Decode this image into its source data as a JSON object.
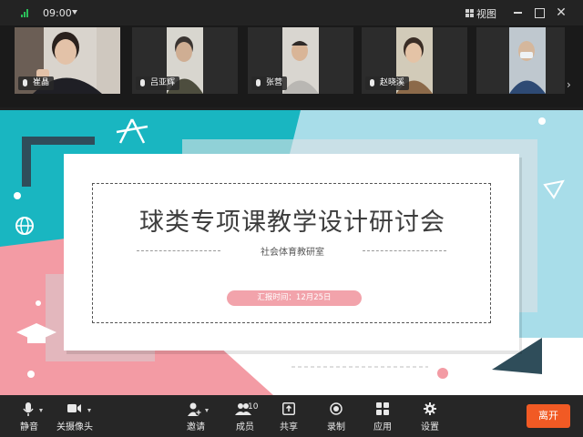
{
  "status_bar": {
    "time": "09:00",
    "view_label": "视图"
  },
  "participants": [
    {
      "name": "崔晶"
    },
    {
      "name": "吕亚辉"
    },
    {
      "name": "张营"
    },
    {
      "name": "赵晓溪"
    },
    {
      "name": ""
    }
  ],
  "slide": {
    "title": "球类专项课教学设计研讨会",
    "subtitle": "社会体育教研室",
    "date_text": "汇报时间：12月25日"
  },
  "toolbar": {
    "mute_label": "静音",
    "camera_label": "关摄像头",
    "invite_label": "邀请",
    "members_label": "成员",
    "members_count": "10",
    "share_label": "共享",
    "record_label": "录制",
    "apps_label": "应用",
    "settings_label": "设置",
    "leave_label": "离开"
  },
  "colors": {
    "accent_leave": "#f15a24",
    "slide_teal": "#19b6c1",
    "slide_pink": "#f39ba4",
    "slide_lightblue": "#a8dde9",
    "signal_green": "#2bbf5a"
  }
}
